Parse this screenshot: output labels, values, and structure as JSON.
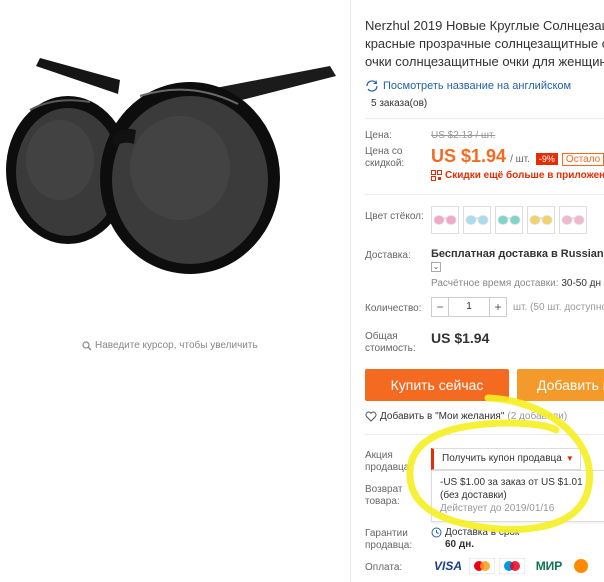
{
  "gallery": {
    "zoom_hint": "Наведите курсор, чтобы увеличить"
  },
  "product": {
    "title_lines": [
      "Nerzhul 2019 Новые Круглые Солнцезащит",
      "красные прозрачные солнцезащитные оч",
      "очки солнцезащитные очки для женщин s"
    ],
    "translate_link": "Посмотреть название на английском",
    "orders": "5 заказа(ов)"
  },
  "pricing": {
    "price_label": "Цена:",
    "old_price": "US $2.13 / шт.",
    "discount_label": "Цена со скидкой:",
    "price": "US $1.94",
    "unit": "/ шт.",
    "discount_badge": "-9%",
    "remaining_tag": "Остало",
    "app_discount": "Скидки ещё больше в приложени"
  },
  "options": {
    "lens_color_label": "Цвет стёкол:",
    "lens_colors": [
      "#f2a8c8",
      "#a8dcef",
      "#7fd6c8",
      "#f4d26a",
      "#f0b8cf"
    ]
  },
  "shipping": {
    "label": "Доставка:",
    "method": "Бесплатная доставка в Russian Fed",
    "time_label": "Расчётное время доставки:",
    "time_value": "30-50 дн"
  },
  "quantity": {
    "label": "Количество:",
    "minus": "−",
    "value": "1",
    "plus": "+",
    "note": "шт. (50 шт. доступно"
  },
  "total": {
    "label": "Общая стоимость:",
    "value": "US $1.94"
  },
  "actions": {
    "buy_now": "Купить сейчас",
    "add_to_cart": "Добавить в",
    "wishlist": "Добавить в \"Мои желания\"",
    "wishlist_count": "(2 добавили)"
  },
  "seller_promo": {
    "label": "Акция продавца:",
    "coupon_button": "Получить купон продавца",
    "coupon_text": "-US $1.00 за заказ от US $1.01",
    "coupon_note": "(без доставки)",
    "coupon_valid": "Действует до 2019/01/16"
  },
  "returns": {
    "label": "Возврат товара:"
  },
  "guarantee": {
    "label": "Гарантии продавца:",
    "value_line1": "Доставка в срок",
    "value_line2": "60 дн."
  },
  "payment": {
    "label": "Оплата:",
    "methods": [
      "VISA",
      "MasterCard",
      "Maestro",
      "МИР",
      "QIWI"
    ]
  },
  "colors": {
    "accent": "#f46a21",
    "cart": "#f39a2a",
    "link": "#2561a8",
    "sale_red": "#e62e04",
    "highlight": "#f5f020"
  }
}
